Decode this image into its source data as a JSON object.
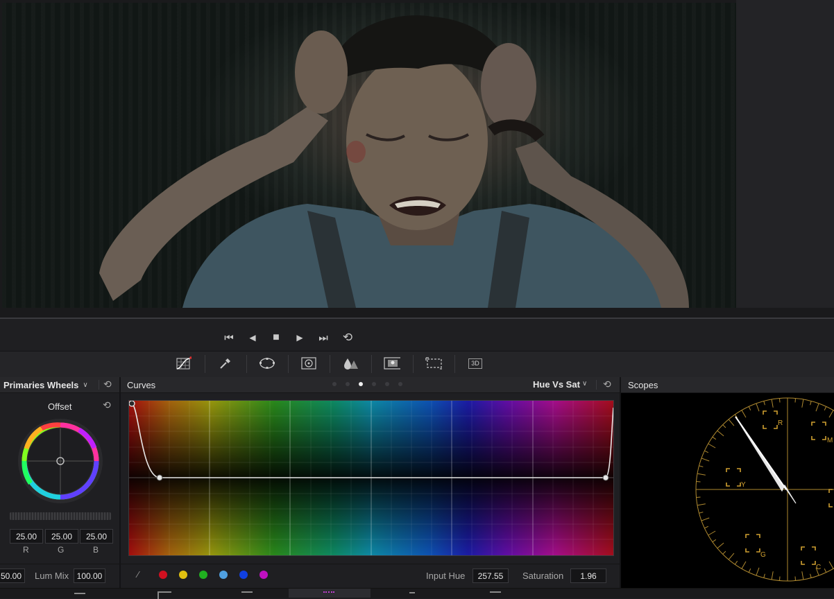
{
  "transport": {
    "first_frame": "⏮",
    "prev": "◀",
    "stop": "■",
    "play": "▶",
    "last_frame": "⏭",
    "loop": "⟲"
  },
  "toolbar": {
    "tools": [
      "curves-icon",
      "qualifier-icon",
      "window-icon",
      "tracker-icon",
      "blur-icon",
      "key-icon",
      "sizing-icon",
      "3d-icon"
    ],
    "threed_label": "3D"
  },
  "primaries": {
    "title": "Primaries Wheels",
    "wheel_label": "Offset",
    "rgb_values": [
      "25.00",
      "25.00",
      "25.00"
    ],
    "rgb_labels": [
      "R",
      "G",
      "B"
    ],
    "left_value": "50.00",
    "lum_mix_label": "Lum Mix",
    "lum_mix_value": "100.00"
  },
  "curves": {
    "title": "Curves",
    "mode": "Hue Vs Sat",
    "input_hue_label": "Input Hue",
    "input_hue_value": "257.55",
    "saturation_label": "Saturation",
    "saturation_value": "1.96",
    "swatch_colors": [
      "#d01020",
      "#e0c010",
      "#20b020",
      "#50a0e0",
      "#1040e0",
      "#c010c0"
    ]
  },
  "scopes": {
    "title": "Scopes",
    "targets": [
      "R",
      "M",
      "Y",
      "G",
      "C"
    ]
  },
  "bottom_nav": {
    "pages": [
      "media-icon",
      "cut-icon",
      "fusion-icon",
      "color-icon",
      "fairlight-icon",
      "deliver-icon"
    ]
  }
}
